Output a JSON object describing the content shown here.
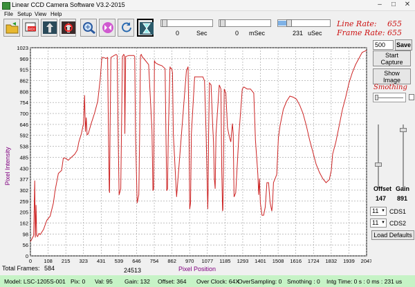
{
  "window": {
    "title": "Linear CCD Camera Software V3.2-2015",
    "minimize": "–",
    "maximize": "□",
    "close": "✕"
  },
  "menu": {
    "items": [
      "File",
      "Setup",
      "View",
      "Help"
    ]
  },
  "toolbar": {
    "buttons": [
      {
        "name": "open-icon"
      },
      {
        "name": "roi-icon"
      },
      {
        "name": "capture-icon"
      },
      {
        "name": "stop-icon"
      },
      {
        "name": "zoom-icon"
      },
      {
        "name": "flip-icon"
      },
      {
        "name": "refresh-icon"
      },
      {
        "name": "hourglass-icon"
      }
    ]
  },
  "exposure": {
    "sec_value": "0",
    "sec_unit": "Sec",
    "msec_value": "0",
    "msec_unit": "mSec",
    "usec_value": "231",
    "usec_unit": "uSec"
  },
  "rates": {
    "line_label": "Line Rate:",
    "line_value": "655",
    "frame_label": "Frame Rate:",
    "frame_value": "655"
  },
  "side_panel": {
    "frames_value": "500",
    "save_label": "Save",
    "start_capture_line1": "Start",
    "start_capture_line2": "Capture",
    "show_image_line1": "Show",
    "show_image_line2": "Image",
    "smoothing_label": "Smothing",
    "offset_label": "Offset",
    "offset_value": "147",
    "gain_label": "Gain",
    "gain_value": "891",
    "cds1_value": "11",
    "cds1_label": "CDS1",
    "cds2_value": "11",
    "cds2_label": "CDS2",
    "load_defaults_label": "Load Defaults"
  },
  "bottom": {
    "total_frames_label": "Total Frames:",
    "total_frames_value": "584",
    "secondary_count": "24513"
  },
  "status": {
    "model": "Model:  LSC-1205S-001",
    "pix": "Pix: 0",
    "val": "Val: 95",
    "gain": "Gain: 132",
    "offset": "Offset: 364",
    "over_clock": "Over Clock: 64X",
    "over_sampling": "OverSampling: 0",
    "smothing": "Smothing : 0",
    "intg_time": "Intg Time: 0 s :   0 ms :   231 us"
  },
  "colors": {
    "trace": "#cc2222",
    "axis_label": "#800080",
    "status_bg": "#c6f3c6"
  },
  "chart_data": {
    "type": "line",
    "xlabel": "Pixel Position",
    "ylabel": "Pixel Intensity",
    "xlim": [
      0,
      2047
    ],
    "ylim": [
      0,
      1023
    ],
    "grid": true,
    "x_ticks": [
      "0",
      "108",
      "215",
      "323",
      "431",
      "539",
      "646",
      "754",
      "862",
      "970",
      "1077",
      "1185",
      "1293",
      "1401",
      "1508",
      "1616",
      "1724",
      "1832",
      "1939",
      "2047"
    ],
    "y_ticks": [
      "0",
      "56",
      "98",
      "162",
      "205",
      "259",
      "302",
      "377",
      "430",
      "485",
      "538",
      "592",
      "646",
      "700",
      "754",
      "808",
      "862",
      "915",
      "969",
      "1023"
    ],
    "series": [
      {
        "x": [
          0,
          20,
          26,
          30,
          34,
          38,
          44,
          52,
          60,
          80,
          100,
          120,
          140,
          150,
          170,
          190,
          200,
          215,
          230,
          250,
          270,
          285,
          295,
          310,
          323,
          330,
          335,
          340,
          345,
          352,
          370,
          390,
          410,
          425,
          435,
          445,
          460,
          470,
          475,
          480,
          482,
          485,
          490,
          510,
          522,
          528,
          534,
          540,
          550,
          560,
          568,
          572,
          575,
          580,
          600,
          630,
          635,
          640,
          650,
          660,
          665,
          670,
          675,
          680,
          700,
          720,
          740,
          746,
          750,
          755,
          760,
          780,
          800,
          820,
          825,
          830,
          835,
          840,
          850,
          855,
          860,
          865,
          870,
          890,
          920,
          950,
          960,
          966,
          970,
          975,
          980,
          1000,
          1030,
          1050,
          1060,
          1070,
          1078,
          1080,
          1082,
          1085,
          1090,
          1100,
          1110,
          1115,
          1120,
          1125,
          1130,
          1150,
          1160,
          1165,
          1170,
          1172,
          1175,
          1180,
          1190,
          1200,
          1210,
          1220,
          1230,
          1235,
          1240,
          1245,
          1250,
          1270,
          1290,
          1300,
          1320,
          1340,
          1360,
          1370,
          1380,
          1385,
          1390,
          1395,
          1400,
          1410,
          1420,
          1430,
          1440,
          1450,
          1460,
          1470,
          1475,
          1480,
          1490,
          1500,
          1510,
          1520,
          1540,
          1560,
          1580,
          1600,
          1620,
          1640,
          1660,
          1680,
          1700,
          1720,
          1740,
          1760,
          1780,
          1800,
          1820,
          1832,
          1840,
          1860,
          1880,
          1900,
          1920,
          1940,
          1960,
          1980,
          2000,
          2020,
          2047
        ],
        "y": [
          70,
          100,
          370,
          90,
          250,
          100,
          95,
          110,
          105,
          130,
          175,
          195,
          260,
          320,
          405,
          420,
          480,
          480,
          470,
          485,
          500,
          520,
          560,
          600,
          650,
          790,
          610,
          680,
          595,
          600,
          650,
          700,
          760,
          870,
          975,
          975,
          970,
          975,
          600,
          320,
          310,
          600,
          975,
          985,
          990,
          985,
          600,
          300,
          330,
          980,
          990,
          985,
          600,
          980,
          985,
          985,
          980,
          600,
          260,
          300,
          600,
          985,
          990,
          980,
          960,
          940,
          620,
          320,
          330,
          960,
          950,
          940,
          935,
          920,
          600,
          320,
          330,
          610,
          930,
          920,
          920,
          900,
          600,
          290,
          600,
          910,
          930,
          600,
          230,
          260,
          600,
          880,
          880,
          880,
          860,
          600,
          300,
          230,
          320,
          600,
          850,
          840,
          640,
          560,
          380,
          330,
          600,
          840,
          820,
          420,
          220,
          230,
          420,
          820,
          800,
          630,
          590,
          560,
          650,
          600,
          290,
          300,
          310,
          600,
          820,
          830,
          820,
          820,
          800,
          570,
          460,
          400,
          300,
          380,
          260,
          200,
          200,
          240,
          360,
          360,
          260,
          220,
          270,
          360,
          380,
          400,
          580,
          640,
          720,
          760,
          785,
          780,
          770,
          740,
          700,
          640,
          570,
          510,
          450,
          410,
          380,
          360,
          375,
          420,
          500,
          560,
          640,
          720,
          780,
          850,
          900,
          940,
          970,
          1000,
          1010
        ]
      }
    ]
  }
}
